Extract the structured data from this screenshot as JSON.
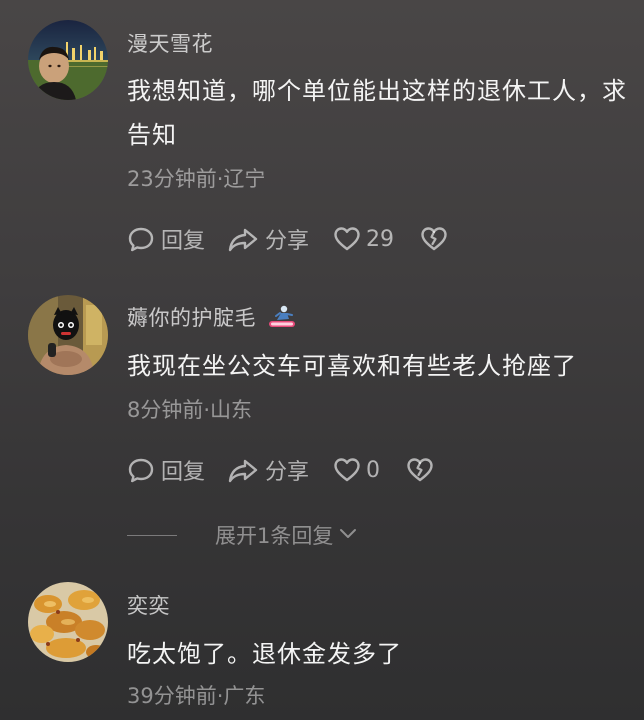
{
  "comments": [
    {
      "username": "漫天雪花",
      "text": "我想知道，哪个单位能出这样的退休工人，求告知",
      "meta": "23分钟前·辽宁",
      "reply_label": "回复",
      "share_label": "分享",
      "likes": "29"
    },
    {
      "username": "薅你的护腚毛",
      "text": "我现在坐公交车可喜欢和有些老人抢座了",
      "meta": "8分钟前·山东",
      "reply_label": "回复",
      "share_label": "分享",
      "likes": "0",
      "expand_replies": "展开1条回复"
    },
    {
      "username": "奕奕",
      "text": "吃太饱了。退休金发多了",
      "meta": "39分钟前·广东"
    }
  ],
  "colors": {
    "background": "#423f40",
    "text_primary": "#f4f4f4",
    "text_secondary": "#9a9899"
  }
}
